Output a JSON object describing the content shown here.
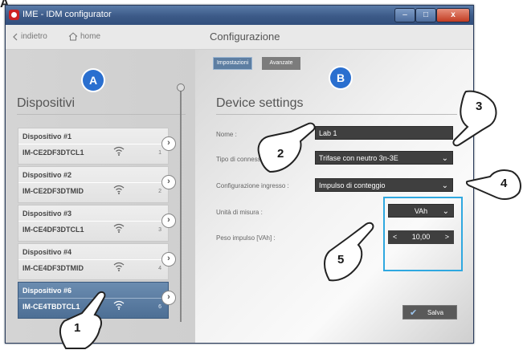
{
  "corner_letter": "A",
  "window": {
    "title": "IME - IDM configurator",
    "min_glyph": "–",
    "max_glyph": "□",
    "close_glyph": "x"
  },
  "nav": {
    "back_label": "indietro",
    "home_label": "home",
    "page_title": "Configurazione"
  },
  "tabs": [
    {
      "label": "Impostazioni",
      "active": true
    },
    {
      "label": "Avanzate",
      "active": false
    }
  ],
  "left_panel": {
    "badge": "A",
    "heading": "Dispositivi",
    "devices": [
      {
        "name": "Dispositivo #1",
        "serial": "IM-CE2DF3DTCL1",
        "index": "1",
        "selected": false
      },
      {
        "name": "Dispositivo #2",
        "serial": "IM-CE2DF3DTMID",
        "index": "2",
        "selected": false
      },
      {
        "name": "Dispositivo #3",
        "serial": "IM-CE4DF3DTCL1",
        "index": "3",
        "selected": false
      },
      {
        "name": "Dispositivo #4",
        "serial": "IM-CE4DF3DTMID",
        "index": "4",
        "selected": false
      },
      {
        "name": "Dispositivo #6",
        "serial": "IM-CE4TBDTCL1",
        "index": "6",
        "selected": true
      }
    ]
  },
  "right_panel": {
    "badge": "B",
    "heading": "Device settings",
    "fields": {
      "nome": {
        "label": "Nome :",
        "value": "Lab 1"
      },
      "tipo": {
        "label": "Tipo di connessione :",
        "value": "Trifase con neutro 3n-3E"
      },
      "config": {
        "label": "Configurazione ingresso :",
        "value": "Impulso di conteggio"
      },
      "unita": {
        "label": "Unità di misura :",
        "value": "VAh"
      },
      "peso": {
        "label": "Peso impulso [VAh] :",
        "value": "10,00"
      }
    },
    "save_label": "Salva"
  },
  "callouts": [
    "1",
    "2",
    "3",
    "4",
    "5"
  ],
  "colors": {
    "accent_blue": "#2a6fcf",
    "highlight_box": "#2fa8e0",
    "selected_device": "#5779a0",
    "field_bg": "#3f3f3f"
  }
}
